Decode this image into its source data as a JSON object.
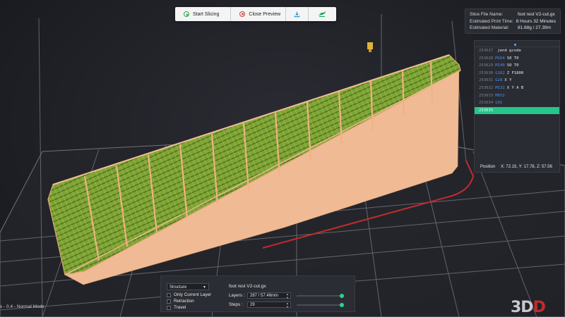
{
  "toolbar": {
    "start_label": "Start Slicing",
    "close_label": "Close Preview",
    "download_icon": "download-icon",
    "print_icon": "print-icon"
  },
  "slice_info": {
    "file_name_label": "Slice File Name:",
    "file_name_value": "foot rest V2-cut.gx",
    "print_time_label": "Estimated Print Time:",
    "print_time_value": "8 Hours 32 Minutes",
    "material_label": "Estimated Material:",
    "material_value": "81.68g / 27.39m"
  },
  "gcode": {
    "lines": [
      {
        "num": "253627",
        "cmd": "",
        "args": "jend gcode"
      },
      {
        "num": "253628",
        "cmd": "M104",
        "args": "S0 T0"
      },
      {
        "num": "253629",
        "cmd": "M140",
        "args": "S0 T0"
      },
      {
        "num": "253630",
        "cmd": "G162",
        "args": "Z F1800"
      },
      {
        "num": "253631",
        "cmd": "G28",
        "args": "X Y"
      },
      {
        "num": "253632",
        "cmd": "M132",
        "args": "X Y A B"
      },
      {
        "num": "253633",
        "cmd": "M652",
        "args": ""
      },
      {
        "num": "253634",
        "cmd": "G91",
        "args": ""
      },
      {
        "num": "253635",
        "cmd": "",
        "args": "",
        "active": true
      }
    ],
    "position_label": "Position",
    "position_value": "X: 72.15, Y: 17.78, Z: 57.56"
  },
  "controls": {
    "view_select": "Structure",
    "options": [
      "Only Current Layer",
      "Retraction",
      "Travel"
    ],
    "file_name": "foot rest V2-cut.gx",
    "layers_label": "Layers :",
    "layers_value": "287 / 57.46mm",
    "layers_fraction": 1.0,
    "steps_label": "Steps :",
    "steps_value": "29",
    "steps_fraction": 1.0
  },
  "status": {
    "mode_text": "s - 0.4 - Normal Mode"
  },
  "brand": {
    "logo_text_main": "3D",
    "logo_text_accent": "D"
  },
  "colors": {
    "accent_green": "#25c68a",
    "gcode_blue": "#4a8ef0",
    "model_fill": "#f2bd94",
    "infill_green": "#6b9a2a",
    "axis_red": "#c62b2b"
  }
}
